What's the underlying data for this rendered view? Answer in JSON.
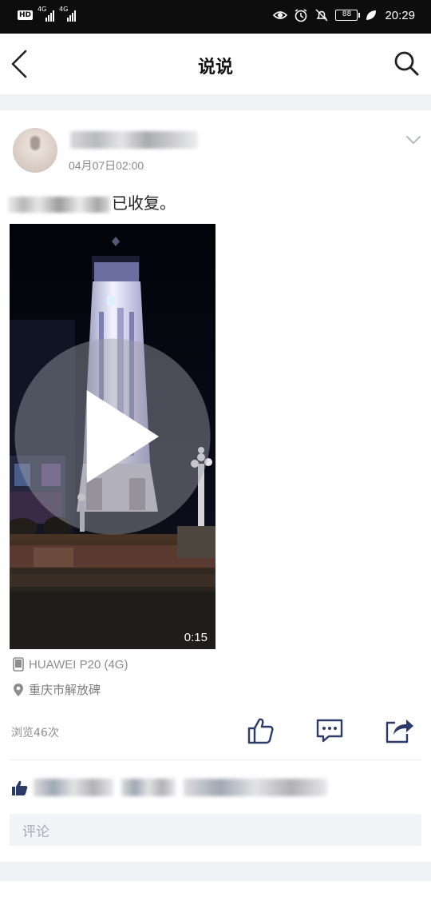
{
  "status_bar": {
    "hd": "HD",
    "sim1": "4G",
    "sim2": "4G",
    "battery": "88",
    "time": "20:29"
  },
  "header": {
    "title": "说说",
    "back_icon": "chevron-left-icon",
    "search_icon": "search-icon"
  },
  "post": {
    "time": "04月07日02:00",
    "text_suffix": "已收复。",
    "video": {
      "duration": "0:15"
    },
    "device": "HUAWEI P20 (4G)",
    "location": "重庆市解放碑",
    "views": "浏览46次"
  },
  "comment": {
    "placeholder": "评论"
  },
  "colors": {
    "status_bg": "#0d0d0d",
    "page_bg": "#ffffff",
    "strip_bg": "#f0f1f5",
    "meta_text": "#8d8d8d",
    "icon": "#2b3a67"
  }
}
